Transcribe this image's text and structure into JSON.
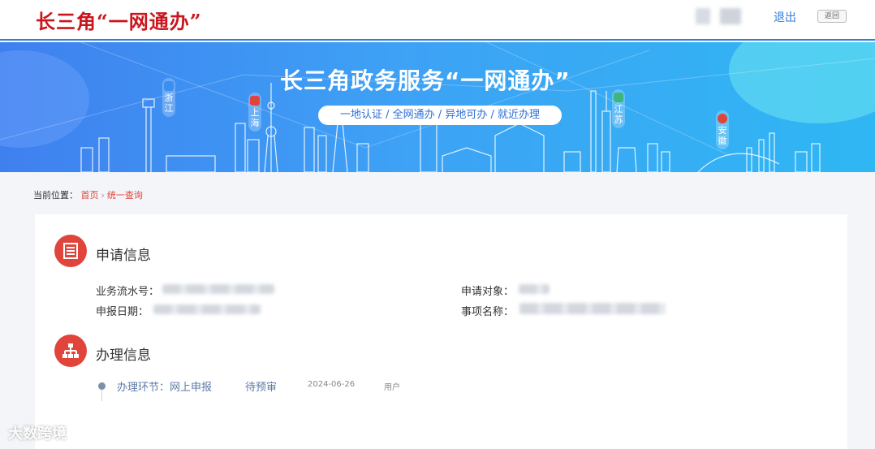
{
  "header": {
    "logo_text": "长三角“一网通办”",
    "logout_label": "退出",
    "back_label": "返回"
  },
  "banner": {
    "title": "长三角政务服务“一网通办”",
    "subtitle": "一地认证 / 全网通办 / 异地可办 / 就近办理",
    "provinces": [
      "浙江",
      "上海",
      "江苏",
      "安徽"
    ]
  },
  "breadcrumb": {
    "prefix": "当前位置：",
    "home": "首页",
    "separator": "›",
    "current": "统一查询"
  },
  "application_info": {
    "title": "申请信息",
    "serial_label": "业务流水号：",
    "date_label": "申报日期：",
    "applicant_label": "申请对象：",
    "item_label": "事项名称："
  },
  "process_info": {
    "title": "办理信息",
    "step_label": "办理环节：网上申报",
    "status": "待预审",
    "date": "2024-06-26",
    "operator": "用户"
  },
  "watermark": "大数跨境",
  "colors": {
    "brand_red": "#c8161d",
    "accent_red": "#e0443a",
    "link_blue": "#2f7fe0",
    "banner_blue": "#3f80ef"
  }
}
